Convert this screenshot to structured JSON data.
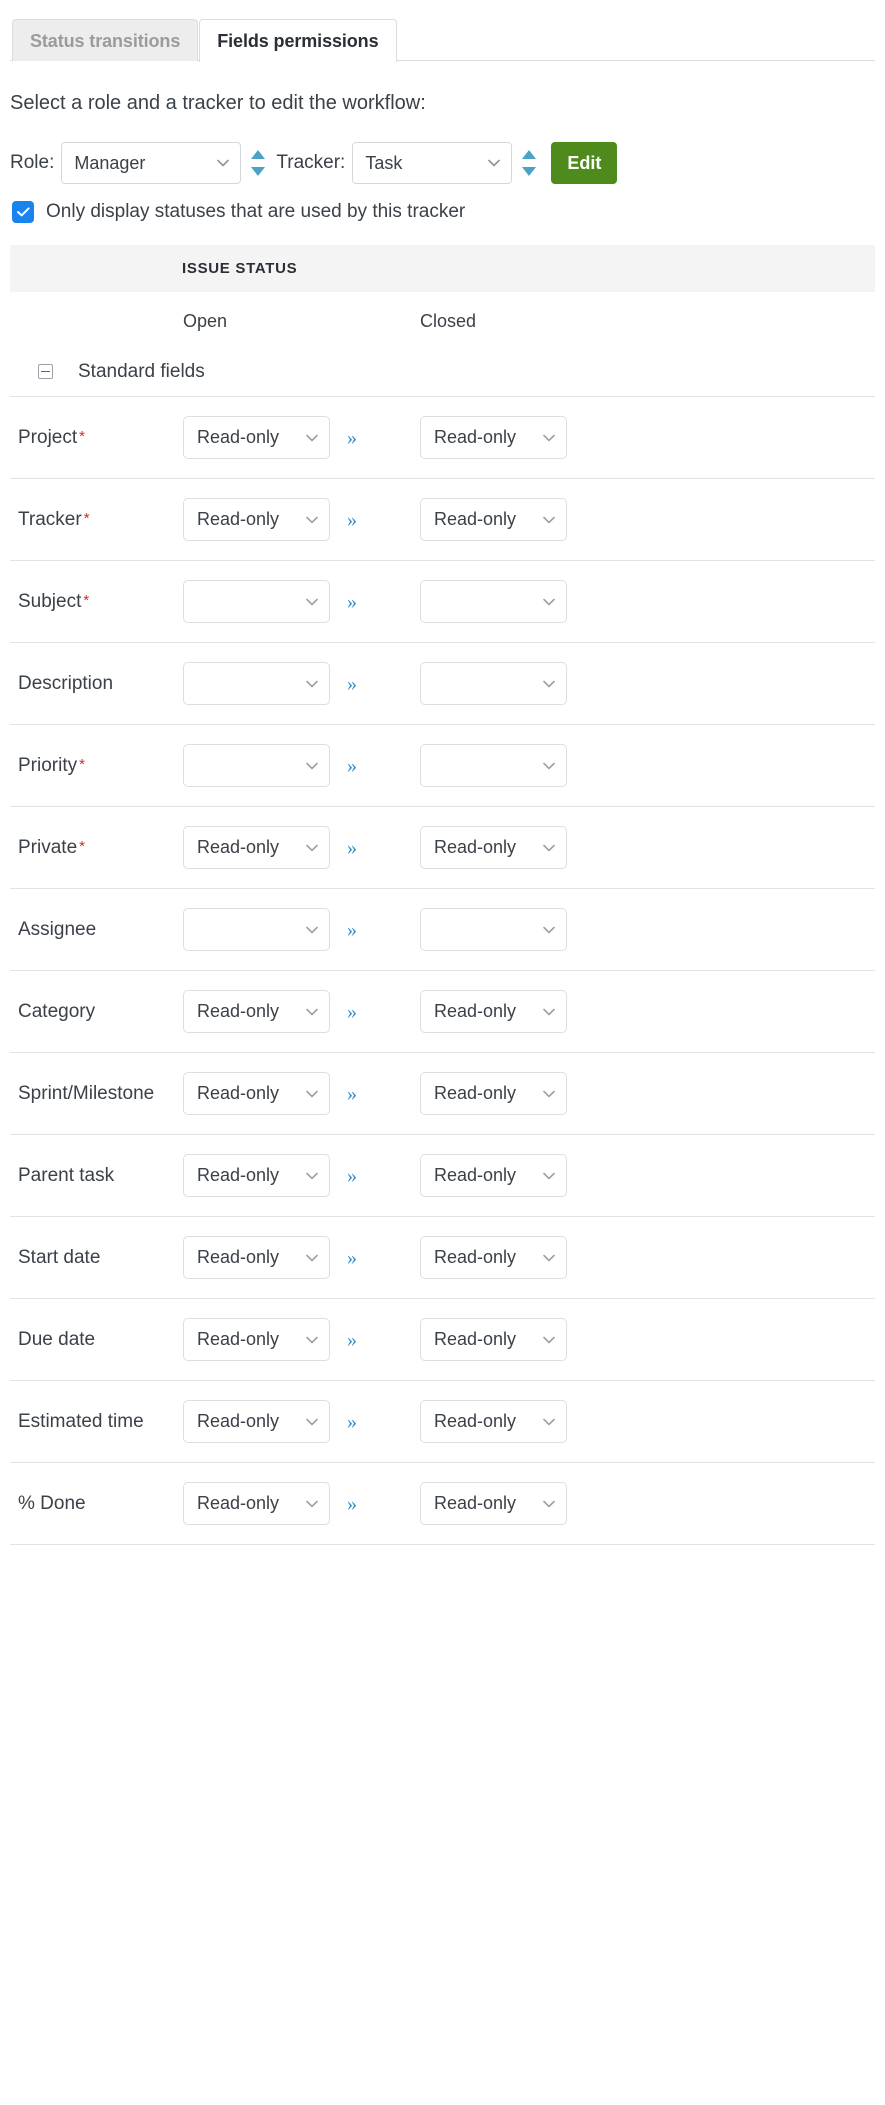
{
  "tabs": [
    {
      "label": "Status transitions",
      "active": false
    },
    {
      "label": "Fields permissions",
      "active": true
    }
  ],
  "intro": "Select a role and a tracker to edit the workflow:",
  "filters": {
    "role_label": "Role:",
    "role_value": "Manager",
    "tracker_label": "Tracker:",
    "tracker_value": "Task",
    "edit_label": "Edit"
  },
  "checkbox": {
    "checked": true,
    "label": "Only display statuses that are used by this tracker"
  },
  "table": {
    "band_title": "ISSUE STATUS",
    "columns": [
      "Open",
      "Closed"
    ],
    "group": {
      "label": "Standard fields",
      "expanded": true
    },
    "copy_arrow": "»",
    "rows": [
      {
        "field": "Project",
        "required": true,
        "open": "Read-only",
        "closed": "Read-only"
      },
      {
        "field": "Tracker",
        "required": true,
        "open": "Read-only",
        "closed": "Read-only"
      },
      {
        "field": "Subject",
        "required": true,
        "open": "",
        "closed": ""
      },
      {
        "field": "Description",
        "required": false,
        "open": "",
        "closed": ""
      },
      {
        "field": "Priority",
        "required": true,
        "open": "",
        "closed": ""
      },
      {
        "field": "Private",
        "required": true,
        "open": "Read-only",
        "closed": "Read-only"
      },
      {
        "field": "Assignee",
        "required": false,
        "open": "",
        "closed": ""
      },
      {
        "field": "Category",
        "required": false,
        "open": "Read-only",
        "closed": "Read-only"
      },
      {
        "field": "Sprint/Milestone",
        "required": false,
        "open": "Read-only",
        "closed": "Read-only"
      },
      {
        "field": "Parent task",
        "required": false,
        "open": "Read-only",
        "closed": "Read-only"
      },
      {
        "field": "Start date",
        "required": false,
        "open": "Read-only",
        "closed": "Read-only"
      },
      {
        "field": "Due date",
        "required": false,
        "open": "Read-only",
        "closed": "Read-only"
      },
      {
        "field": "Estimated time",
        "required": false,
        "open": "Read-only",
        "closed": "Read-only"
      },
      {
        "field": "% Done",
        "required": false,
        "open": "Read-only",
        "closed": "Read-only"
      }
    ]
  },
  "colors": {
    "accent_green": "#4e8a1c",
    "accent_blue": "#1a84ee",
    "spinner_blue": "#4aa3c4",
    "link_blue": "#3a8bc4",
    "required_red": "#cf2a2a"
  }
}
